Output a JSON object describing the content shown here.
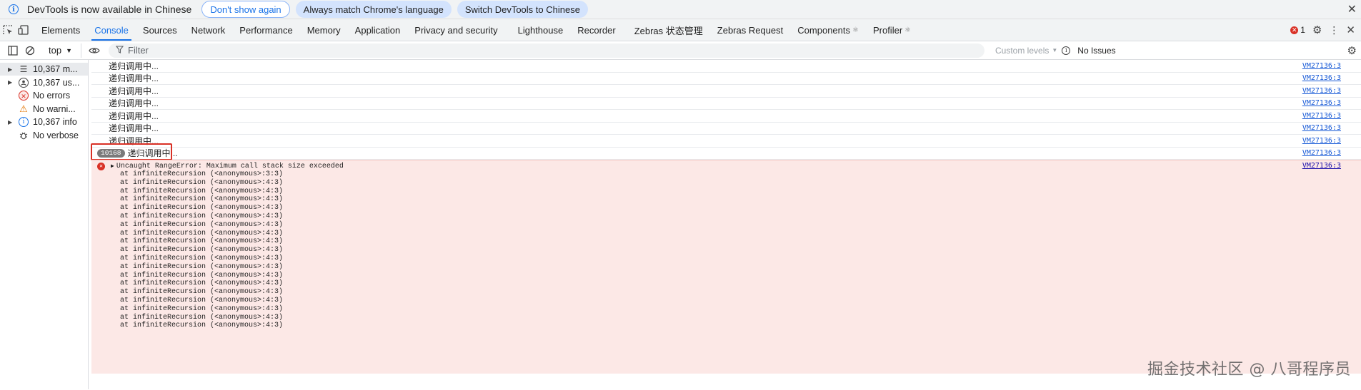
{
  "infobar": {
    "message": "DevTools is now available in Chinese",
    "dont_show": "Don't show again",
    "always_match": "Always match Chrome's language",
    "switch": "Switch DevTools to Chinese"
  },
  "tabs": [
    "Elements",
    "Console",
    "Sources",
    "Network",
    "Performance",
    "Memory",
    "Application",
    "Privacy and security",
    "Lighthouse",
    "Recorder",
    "Zebras 状态管理",
    "Zebras Request",
    "Components",
    "Profiler"
  ],
  "active_tab": "Console",
  "error_count": "1",
  "toolbar": {
    "context": "top",
    "filter_placeholder": "Filter",
    "levels": "Custom levels",
    "issues": "No Issues"
  },
  "sidebar": [
    {
      "label": "10,367 m...",
      "icon": "list-icon"
    },
    {
      "label": "10,367 us...",
      "icon": "user-icon"
    },
    {
      "label": "No errors",
      "icon": "error-icon"
    },
    {
      "label": "No warni...",
      "icon": "warning-icon"
    },
    {
      "label": "10,367 info",
      "icon": "info-icon"
    },
    {
      "label": "No verbose",
      "icon": "bug-icon"
    }
  ],
  "log_rows": [
    {
      "text": "递归调用中...",
      "src": "VM27136:3"
    },
    {
      "text": "递归调用中...",
      "src": "VM27136:3"
    },
    {
      "text": "递归调用中...",
      "src": "VM27136:3"
    },
    {
      "text": "递归调用中...",
      "src": "VM27136:3"
    },
    {
      "text": "递归调用中...",
      "src": "VM27136:3"
    },
    {
      "text": "递归调用中...",
      "src": "VM27136:3"
    },
    {
      "text": "递归调用中...",
      "src": "VM27136:3"
    }
  ],
  "grouped_row": {
    "count": "10168",
    "text": "递归调用中...",
    "src": "VM27136:3"
  },
  "error": {
    "message": "Uncaught RangeError: Maximum call stack size exceeded",
    "src": "VM27136:3",
    "frames": [
      "at infiniteRecursion (<anonymous>:3:3)",
      "at infiniteRecursion (<anonymous>:4:3)",
      "at infiniteRecursion (<anonymous>:4:3)",
      "at infiniteRecursion (<anonymous>:4:3)",
      "at infiniteRecursion (<anonymous>:4:3)",
      "at infiniteRecursion (<anonymous>:4:3)",
      "at infiniteRecursion (<anonymous>:4:3)",
      "at infiniteRecursion (<anonymous>:4:3)",
      "at infiniteRecursion (<anonymous>:4:3)",
      "at infiniteRecursion (<anonymous>:4:3)",
      "at infiniteRecursion (<anonymous>:4:3)",
      "at infiniteRecursion (<anonymous>:4:3)",
      "at infiniteRecursion (<anonymous>:4:3)",
      "at infiniteRecursion (<anonymous>:4:3)",
      "at infiniteRecursion (<anonymous>:4:3)",
      "at infiniteRecursion (<anonymous>:4:3)",
      "at infiniteRecursion (<anonymous>:4:3)",
      "at infiniteRecursion (<anonymous>:4:3)",
      "at infiniteRecursion (<anonymous>:4:3)"
    ]
  },
  "watermark": "掘金技术社区 @ 八哥程序员"
}
